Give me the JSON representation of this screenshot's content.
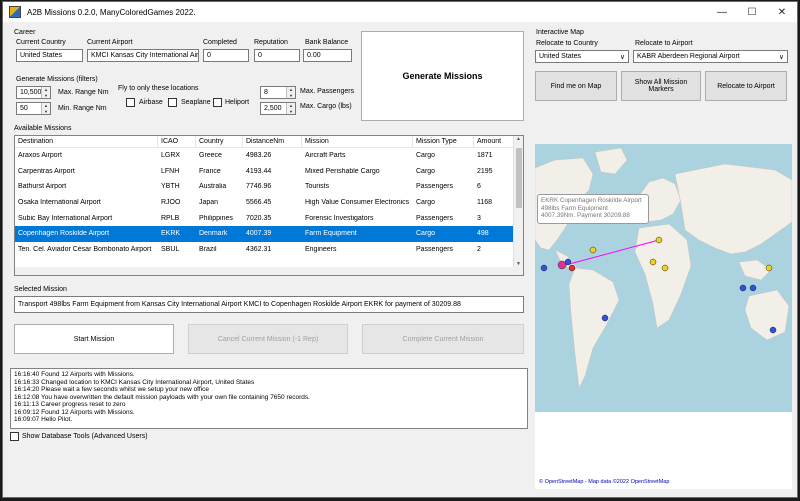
{
  "window": {
    "title": "A2B Missions 0.2.0, ManyColoredGames 2022."
  },
  "career": {
    "section_label": "Career",
    "current_country_label": "Current Country",
    "current_country": "United States",
    "current_airport_label": "Current Airport",
    "current_airport": "KMCI Kansas City International Airp",
    "completed_label": "Completed",
    "completed": "0",
    "reputation_label": "Reputation",
    "reputation": "0",
    "bank_balance_label": "Bank Balance",
    "bank_balance": "0.00"
  },
  "filters": {
    "section_label": "Generate Missions (filters)",
    "max_range": "10,500",
    "max_range_label": "Max. Range Nm",
    "min_range": "50",
    "min_range_label": "Min. Range Nm",
    "locations_label": "Fly to only these locations",
    "airbase": "Airbase",
    "seaplane": "Seaplane",
    "heliport": "Heliport",
    "max_passengers": "8",
    "max_passengers_label": "Max. Passengers",
    "max_cargo": "2,500",
    "max_cargo_label": "Max. Cargo (lbs)"
  },
  "generate_button": "Generate Missions",
  "available_label": "Available Missions",
  "columns": [
    "Destination",
    "ICAO",
    "Country",
    "DistanceNm",
    "Mission",
    "Mission Type",
    "Amount"
  ],
  "missions": [
    [
      "Araxos Airport",
      "LGRX",
      "Greece",
      "4983.26",
      "Aircraft Parts",
      "Cargo",
      "1871"
    ],
    [
      "Carpentras Airport",
      "LFNH",
      "France",
      "4193.44",
      "Mixed Perishable Cargo",
      "Cargo",
      "2195"
    ],
    [
      "Bathurst Airport",
      "YBTH",
      "Australia",
      "7746.96",
      "Tourists",
      "Passengers",
      "6"
    ],
    [
      "Osaka International Airport",
      "RJOO",
      "Japan",
      "5566.45",
      "High Value Consumer Electronics",
      "Cargo",
      "1168"
    ],
    [
      "Subic Bay International Airport",
      "RPLB",
      "Philippines",
      "7020.35",
      "Forensic Investigators",
      "Passengers",
      "3"
    ],
    [
      "Copenhagen Roskilde Airport",
      "EKRK",
      "Denmark",
      "4007.39",
      "Farm Equipment",
      "Cargo",
      "498"
    ],
    [
      "Ten. Cel. Aviador César Bombonato Airport",
      "SBUL",
      "Brazil",
      "4362.31",
      "Engineers",
      "Passengers",
      "2"
    ]
  ],
  "selected_label": "Selected Mission",
  "selected_text": "Transport 498lbs Farm Equipment from Kansas City International Airport KMCI to Copenhagen Roskilde Airport EKRK for payment of 30209.88",
  "start_button": "Start Mission",
  "cancel_button": "Cancel Current Mission (-1 Rep)",
  "complete_button": "Complete Current Mission",
  "log": [
    "16:16:40 Found 12 Airports with Missions.",
    "16:16:33 Changed location to KMCI Kansas City International Airport, United States",
    "16:14:20 Please wait a few seconds whilst we setup your new office",
    "16:12:08 You have overwritten the default mission payloads with your own file containing 7650 records.",
    "16:11:13 Career progress reset to zero",
    "16:09:12 Found 12 Airports with Missions.",
    "16:09:07 Hello Pilot."
  ],
  "db_tools_label": "Show Database Tools (Advanced Users)",
  "interactive_map": {
    "section_label": "Interactive Map",
    "relocate_country_label": "Relocate to Country",
    "relocate_country": "United States",
    "relocate_airport_label": "Relocate to Airport",
    "relocate_airport": "KABR Aberdeen Regional Airport",
    "find_me_button": "Find me on Map",
    "show_markers_button": "Show All Mission Markers",
    "relocate_button": "Relocate to Airport",
    "tooltip_line1": "EKRK Copenhagen Roskilde Airport",
    "tooltip_line2": "498lbs Farm Equipment",
    "tooltip_line3": "4007.39Nm. Payment 30209.88",
    "attribution": "© OpenStreetMap - Map data ©2022 OpenStreetMap"
  },
  "colors": {
    "selection": "#0078d7",
    "cargo_marker": "#f0d020",
    "passenger_marker": "#3050e0",
    "route": "#ff00ff"
  }
}
